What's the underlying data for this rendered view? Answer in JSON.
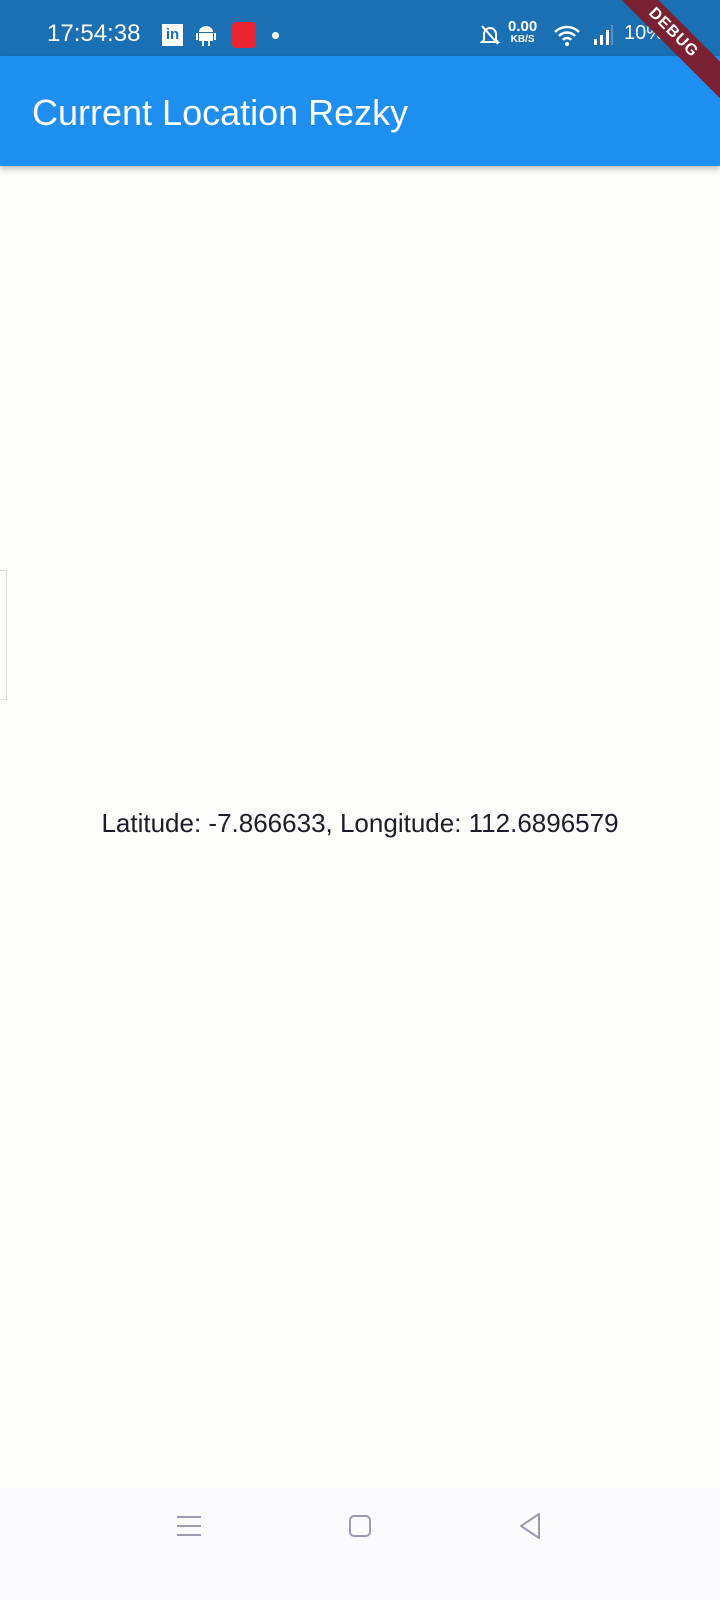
{
  "status_bar": {
    "time": "17:54:38",
    "net_speed": "0.00",
    "net_unit": "KB/S",
    "battery": "10%",
    "icons": [
      "linkedin-icon",
      "android-icon",
      "screen-record-icon",
      "dot-icon",
      "bell-off-icon",
      "wifi-icon",
      "signal-icon"
    ]
  },
  "app_bar": {
    "title": "Current Location Rezky",
    "color": "#1e8ff0"
  },
  "debug_banner": "DEBUG",
  "main": {
    "location_text": "Latitude: -7.866633, Longitude: 112.6896579"
  },
  "nav_bar": {
    "icons": [
      "menu-icon",
      "home-icon",
      "back-icon"
    ]
  }
}
